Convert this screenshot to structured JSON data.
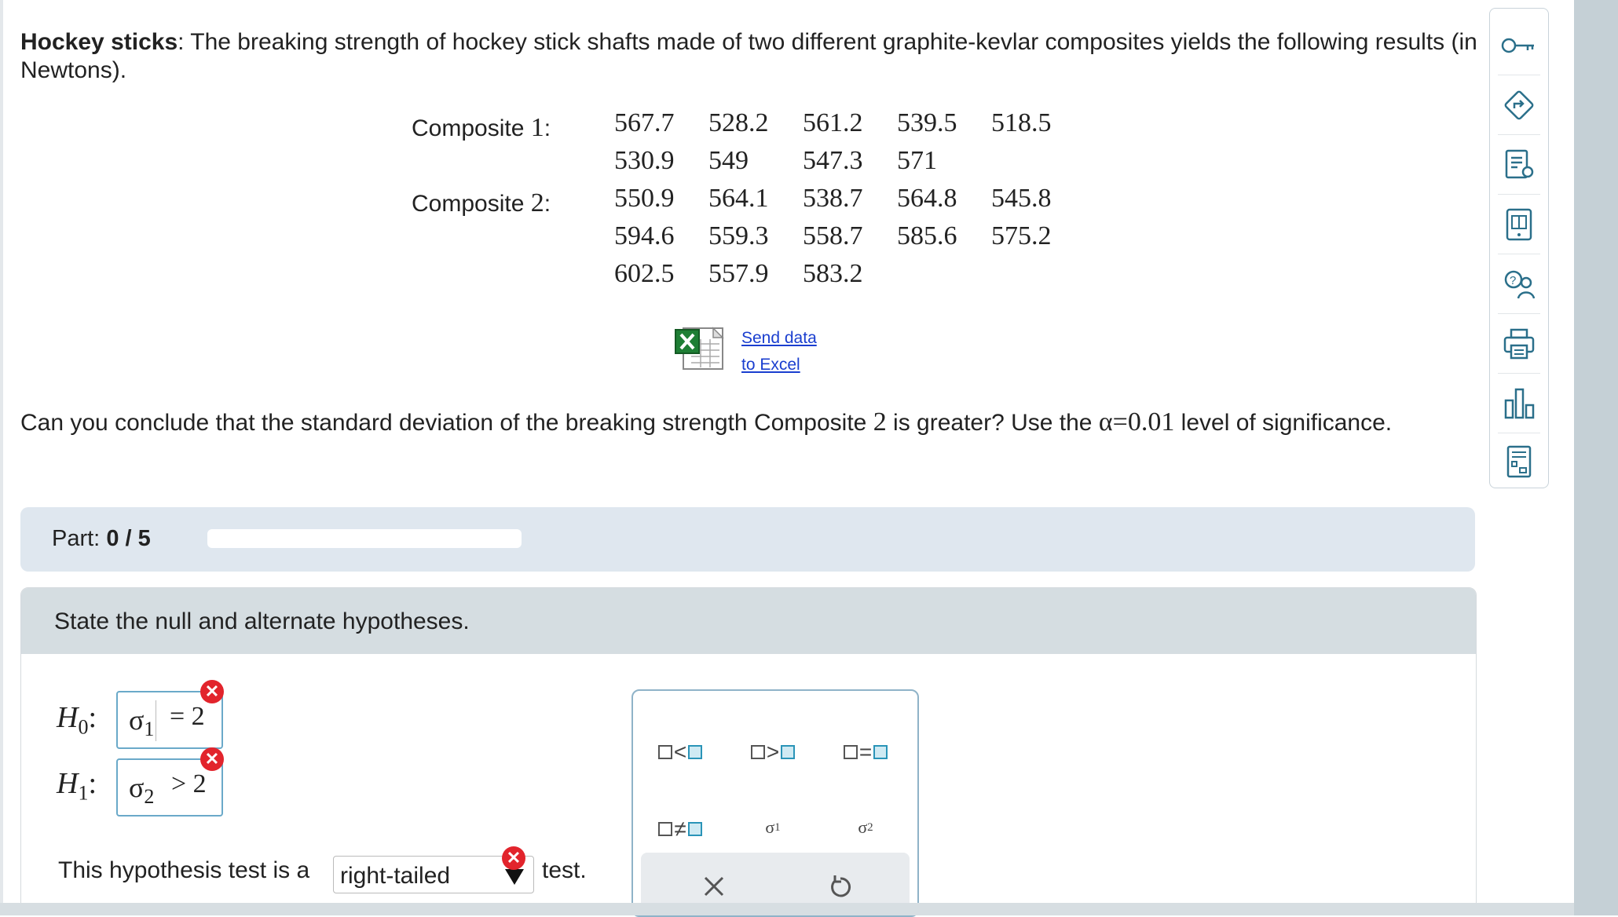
{
  "problem": {
    "title": "Hockey sticks",
    "text": ": The breaking strength of hockey stick shafts made of two different graphite-kevlar composites yields the following results (in Newtons)."
  },
  "data": {
    "composite1_label": "Composite ",
    "composite1_num": "1",
    "composite2_label": "Composite ",
    "composite2_num": "2",
    "composite1_rows": [
      [
        "567.7",
        "528.2",
        "561.2",
        "539.5",
        "518.5"
      ],
      [
        "530.9",
        "549",
        "547.3",
        "571",
        ""
      ]
    ],
    "composite2_rows": [
      [
        "550.9",
        "564.1",
        "538.7",
        "564.8",
        "545.8"
      ],
      [
        "594.6",
        "559.3",
        "558.7",
        "585.6",
        "575.2"
      ],
      [
        "602.5",
        "557.9",
        "583.2",
        "",
        ""
      ]
    ]
  },
  "excel": {
    "line1": "Send data",
    "line2": "to Excel"
  },
  "question": {
    "part1": "Can you conclude that the standard deviation of the breaking strength Composite ",
    "num": "2",
    "part2": " is greater? Use the ",
    "alpha": "α=0.01",
    "part3": " level of significance."
  },
  "part": {
    "label": "Part: ",
    "value": "0 / 5",
    "progress": 0
  },
  "step": {
    "heading": "State the null and alternate hypotheses."
  },
  "hypotheses": {
    "h0_label": "H",
    "h0_sub": "0",
    "h0_sigma": "σ",
    "h0_sigma_sub": "1",
    "h0_rhs": "= 2",
    "h1_label": "H",
    "h1_sub": "1",
    "h1_sigma": "σ",
    "h1_sigma_sub": "2",
    "h1_rhs": "> 2"
  },
  "tail": {
    "prefix": "This hypothesis test is a",
    "selected": "right-tailed",
    "suffix": "test."
  },
  "palette": {
    "sigma1": "σ",
    "sigma1_sub": "1",
    "sigma2": "σ",
    "sigma2_sub": "2"
  },
  "colors": {
    "error": "#e2242c",
    "link": "#1a3ecf",
    "accent": "#2a94b8"
  }
}
